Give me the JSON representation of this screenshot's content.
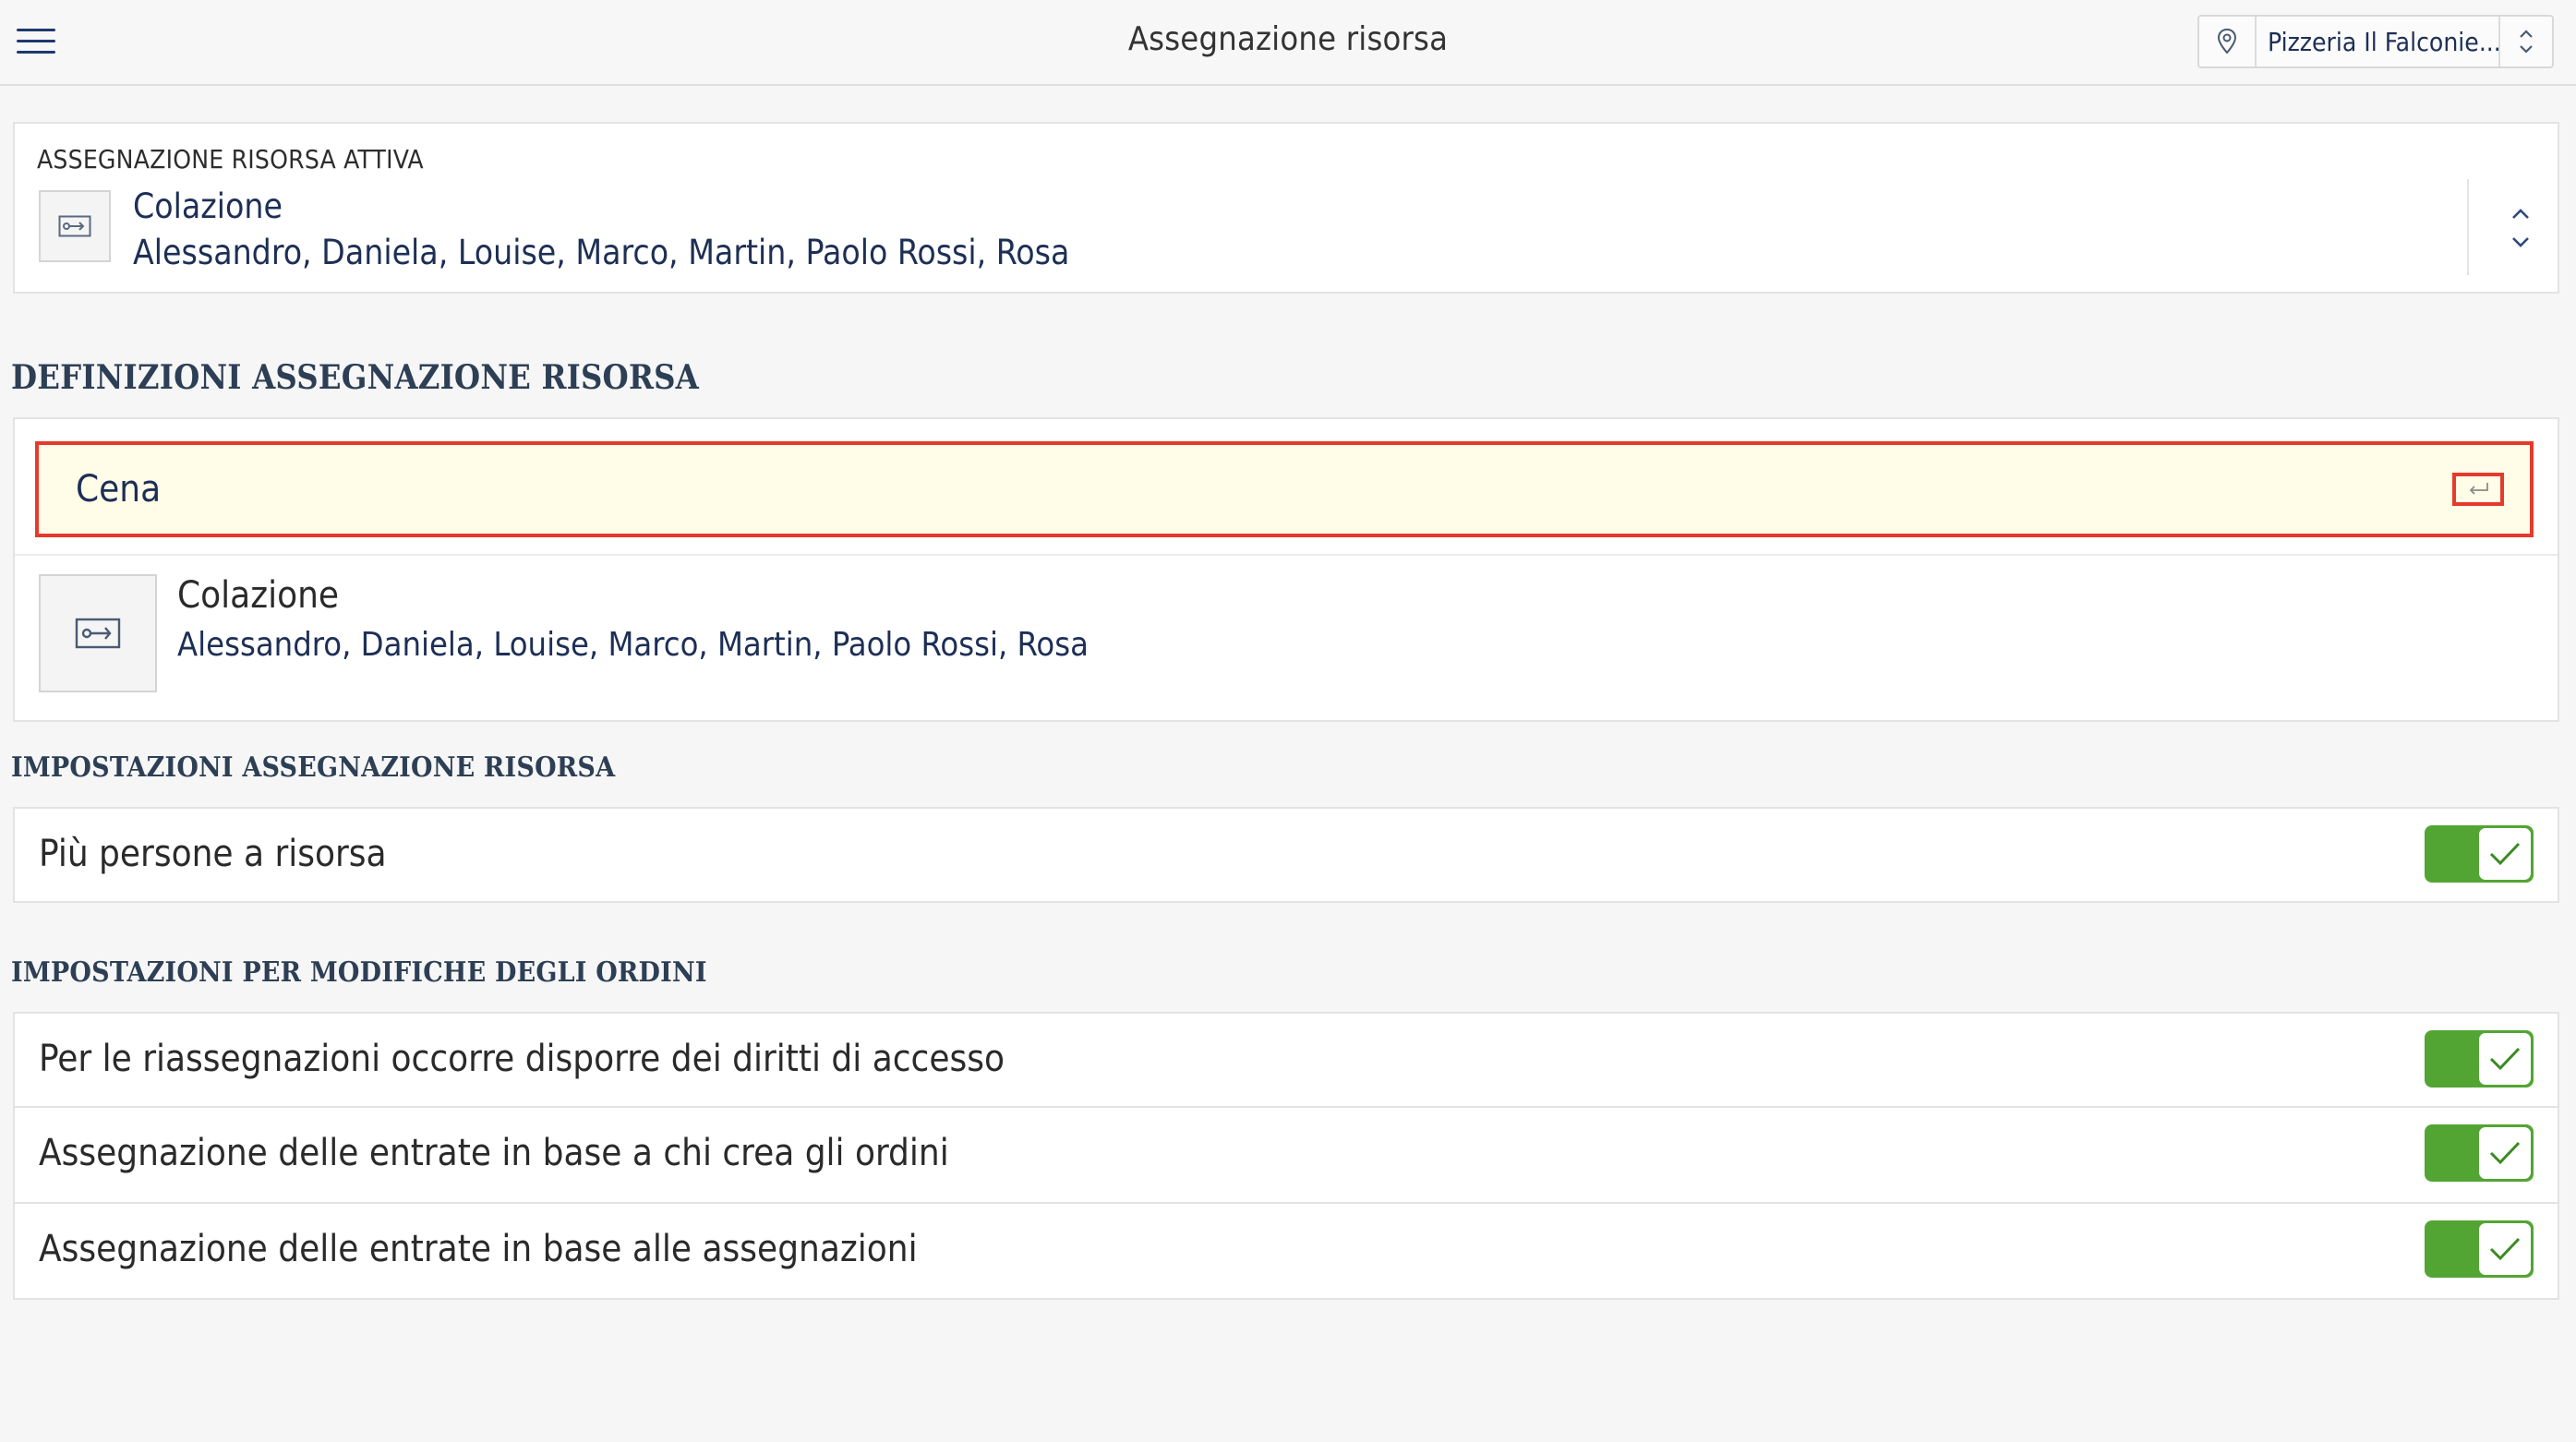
{
  "header": {
    "title": "Assegnazione risorsa",
    "location": "Pizzeria Il Falconie..."
  },
  "active_assignment": {
    "label": "ASSEGNAZIONE RISORSA ATTIVA",
    "name": "Colazione",
    "members": "Alessandro, Daniela, Louise, Marco, Martin, Paolo Rossi, Rosa"
  },
  "definitions": {
    "heading": "DEFINIZIONI ASSEGNAZIONE RISORSA",
    "new_name_value": "Cena",
    "items": [
      {
        "name": "Colazione",
        "members": "Alessandro, Daniela, Louise, Marco, Martin, Paolo Rossi, Rosa"
      }
    ]
  },
  "settings": {
    "heading": "IMPOSTAZIONI ASSEGNAZIONE RISORSA",
    "items": [
      {
        "label": "Più persone a risorsa",
        "enabled": true
      }
    ]
  },
  "order_settings": {
    "heading": "IMPOSTAZIONI PER MODIFICHE DEGLI ORDINI",
    "items": [
      {
        "label": "Per le riassegnazioni occorre disporre dei diritti di accesso",
        "enabled": true
      },
      {
        "label": "Assegnazione delle entrate in base a chi crea gli ordini",
        "enabled": true
      },
      {
        "label": "Assegnazione delle entrate in base alle assegnazioni",
        "enabled": true
      }
    ]
  },
  "colors": {
    "toggle_on": "#53a533",
    "highlight": "#e53a2c",
    "input_bg": "#fffde8",
    "text_primary": "#1d2f55"
  }
}
